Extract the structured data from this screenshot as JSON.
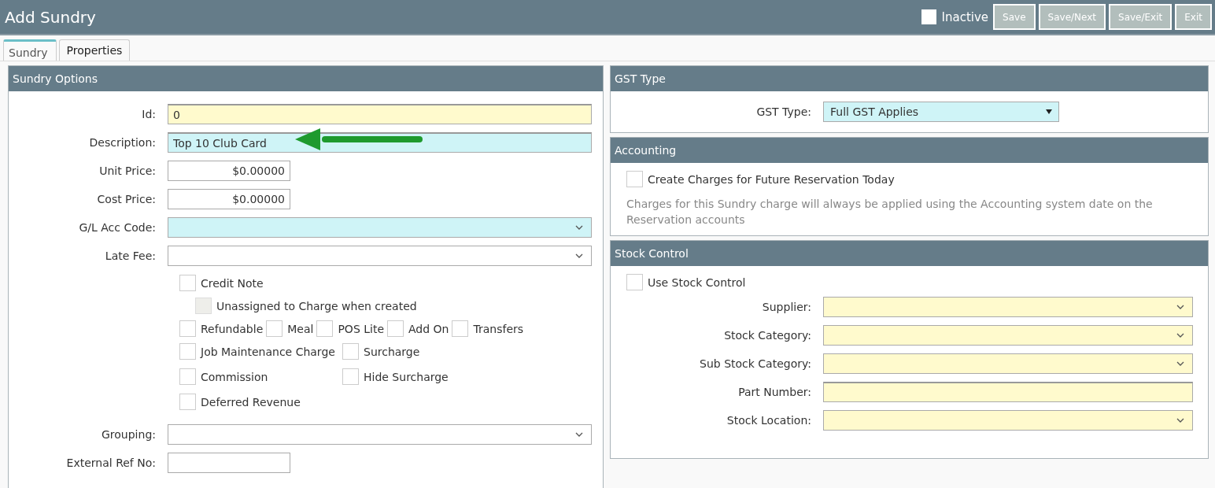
{
  "window": {
    "title": "Add Sundry"
  },
  "header": {
    "inactive": {
      "label": "Inactive",
      "checked": false
    },
    "buttons": [
      "Save",
      "Save/Next",
      "Save/Exit",
      "Exit"
    ]
  },
  "tabs": [
    {
      "label": "Sundry",
      "selected": true
    },
    {
      "label": "Properties",
      "selected": false
    }
  ],
  "sundry_options": {
    "title": "Sundry Options",
    "fields_top": [
      {
        "label": "Id:",
        "kind": "text",
        "value": "0",
        "color": "#fffacd"
      },
      {
        "label": "Description:",
        "kind": "text",
        "value": "Top 10 Club Card",
        "color": "#cff4f7"
      },
      {
        "label": "Unit Price:",
        "kind": "money",
        "value": "$0.00000",
        "color": "#ffffff"
      },
      {
        "label": "Cost Price:",
        "kind": "money",
        "value": "$0.00000",
        "color": "#ffffff"
      },
      {
        "label": "G/L Acc Code:",
        "kind": "select",
        "color": "#cff4f7"
      },
      {
        "label": "Late Fee:",
        "kind": "select",
        "color": "#ffffff"
      }
    ],
    "checkbox_rows": [
      {
        "kind": "inline",
        "items": [
          {
            "label": "Credit Note",
            "checked": false,
            "disabled": false
          }
        ]
      },
      {
        "kind": "indented",
        "items": [
          {
            "label": "Unassigned to Charge when created",
            "checked": false,
            "disabled": true
          }
        ]
      },
      {
        "kind": "inline",
        "items": [
          {
            "label": "Refundable",
            "checked": false,
            "disabled": false
          },
          {
            "label": "Meal",
            "checked": false,
            "disabled": false
          },
          {
            "label": "POS Lite",
            "checked": false,
            "disabled": false
          },
          {
            "label": "Add On",
            "checked": false,
            "disabled": false
          },
          {
            "label": "Transfers",
            "checked": false,
            "disabled": false
          }
        ]
      },
      {
        "kind": "columns",
        "items": [
          {
            "label": "Job Maintenance Charge",
            "checked": false,
            "disabled": false
          },
          {
            "label": "Surcharge",
            "checked": false,
            "disabled": false
          }
        ]
      },
      {
        "kind": "columns",
        "items": [
          {
            "label": "Commission",
            "checked": false,
            "disabled": false
          },
          {
            "label": "Hide Surcharge",
            "checked": false,
            "disabled": false
          }
        ]
      },
      {
        "kind": "columns",
        "items": [
          {
            "label": "Deferred Revenue",
            "checked": false,
            "disabled": false
          }
        ]
      }
    ],
    "fields_bottom": [
      {
        "label": "Grouping:",
        "kind": "select",
        "color": "#ffffff"
      },
      {
        "label": "External Ref No:",
        "kind": "money",
        "color": "#ffffff"
      }
    ]
  },
  "gst_type": {
    "title": "GST Type",
    "fields": [
      {
        "label": "GST Type:",
        "kind": "dropdown",
        "value": "Full GST Applies",
        "color": "#cff4f7"
      }
    ]
  },
  "accounting": {
    "title": "Accounting",
    "checkbox": {
      "label": "Create Charges for Future Reservation Today",
      "checked": false
    },
    "note": "Charges for this Sundry charge will always be applied using the Accounting system date on the Reservation accounts"
  },
  "stock_control": {
    "title": "Stock Control",
    "checkbox": {
      "label": "Use Stock Control",
      "checked": false
    },
    "fields": [
      {
        "label": "Supplier:",
        "kind": "select",
        "color": "#fffacd"
      },
      {
        "label": "Stock Category:",
        "kind": "select",
        "color": "#fffacd"
      },
      {
        "label": "Sub Stock Category:",
        "kind": "select",
        "color": "#fffacd"
      },
      {
        "label": "Part Number:",
        "kind": "text",
        "color": "#fffacd"
      },
      {
        "label": "Stock Location:",
        "kind": "select",
        "color": "#fffacd"
      }
    ]
  }
}
